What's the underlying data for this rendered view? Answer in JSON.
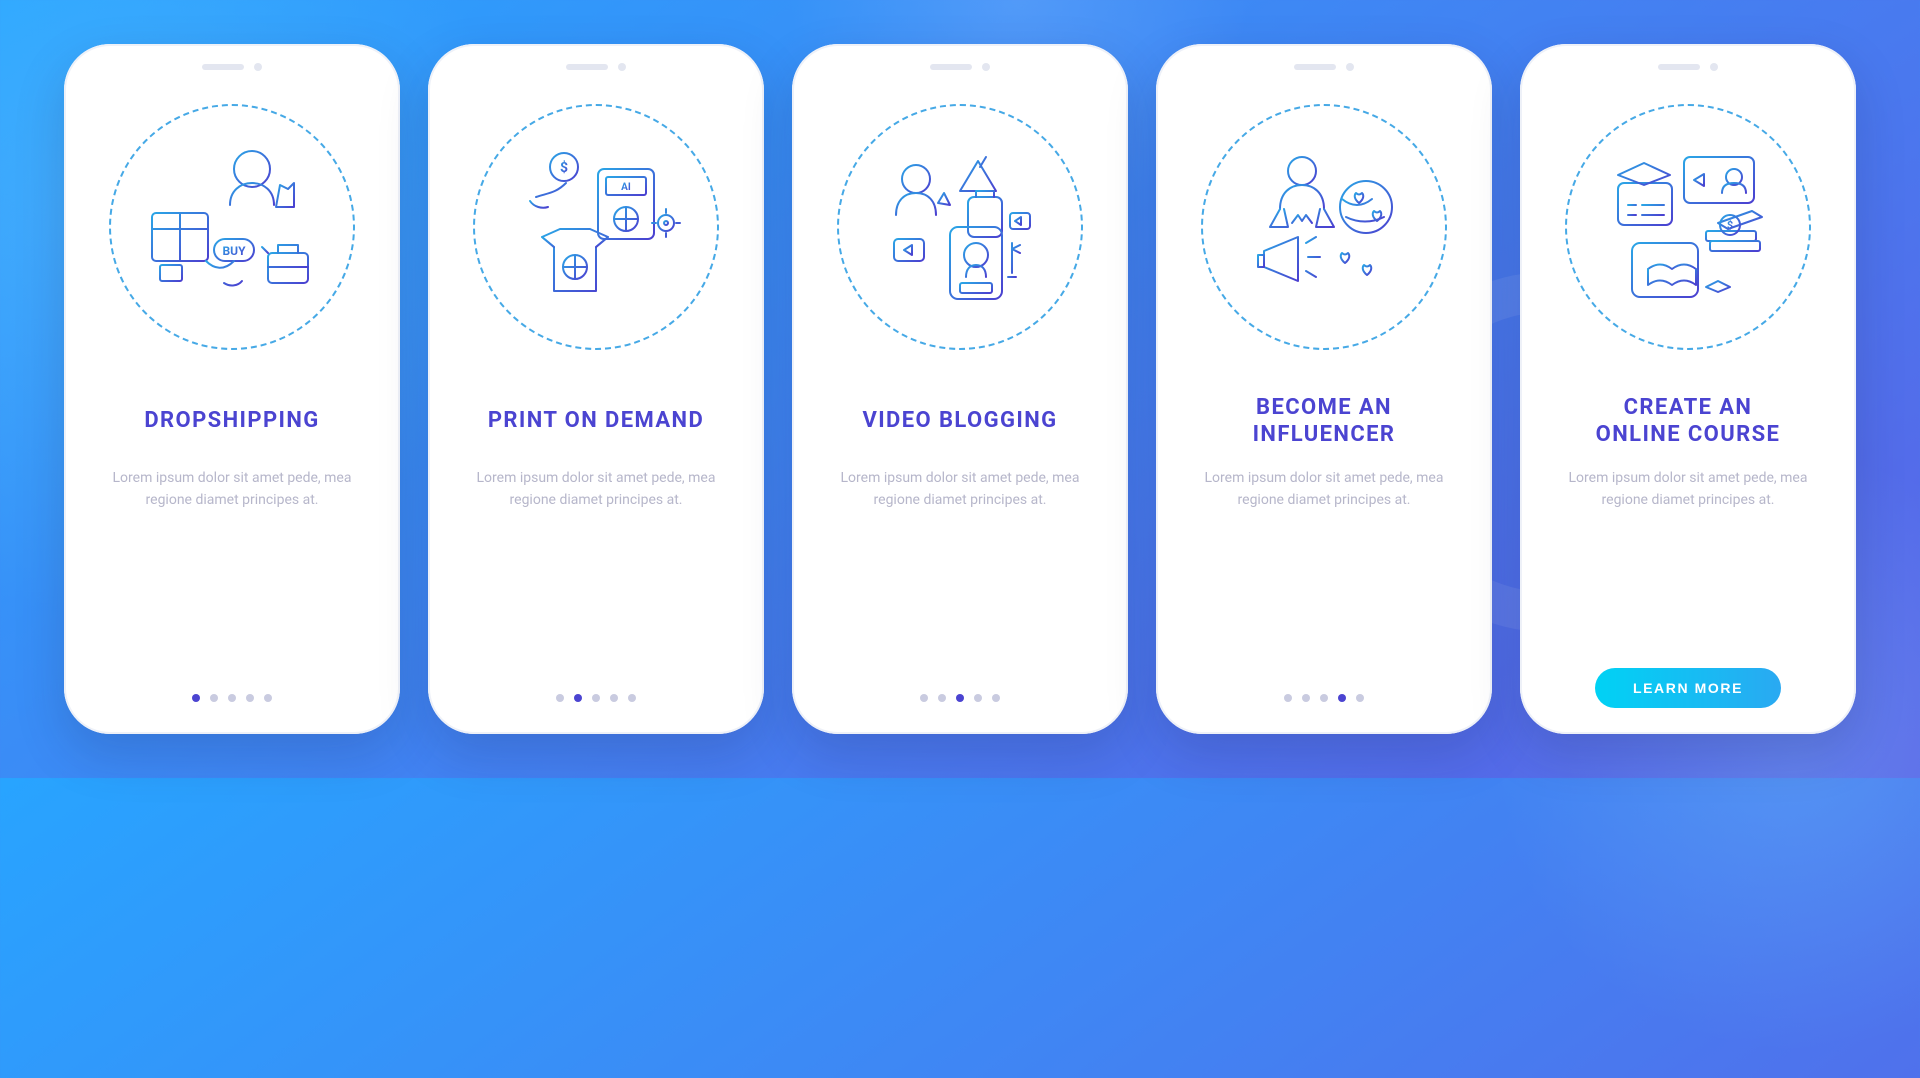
{
  "colors": {
    "background_gradient_from": "#28a4ff",
    "background_gradient_to": "#5b62e6",
    "title": "#4b44d1",
    "body_text": "#b6b6ca",
    "dot_inactive": "#c9cbe0",
    "dot_active": "#4b44d1",
    "button_gradient_from": "#00d2f4",
    "button_gradient_to": "#2aa9f2"
  },
  "total_steps": 5,
  "lorem": "Lorem ipsum dolor sit amet pede, mea regione diamet principes at.",
  "button_label": "LEARN MORE",
  "screens": [
    {
      "index": 0,
      "title": "DROPSHIPPING",
      "icon": "dropshipping-icon",
      "body_key": "lorem",
      "has_button": false
    },
    {
      "index": 1,
      "title": "PRINT ON DEMAND",
      "icon": "print-on-demand-icon",
      "body_key": "lorem",
      "has_button": false
    },
    {
      "index": 2,
      "title": "VIDEO BLOGGING",
      "icon": "video-blogging-icon",
      "body_key": "lorem",
      "has_button": false
    },
    {
      "index": 3,
      "title": "BECOME AN\nINFLUENCER",
      "icon": "influencer-icon",
      "body_key": "lorem",
      "has_button": false
    },
    {
      "index": 4,
      "title": "CREATE AN\nONLINE COURSE",
      "icon": "online-course-icon",
      "body_key": "lorem",
      "has_button": true
    }
  ]
}
